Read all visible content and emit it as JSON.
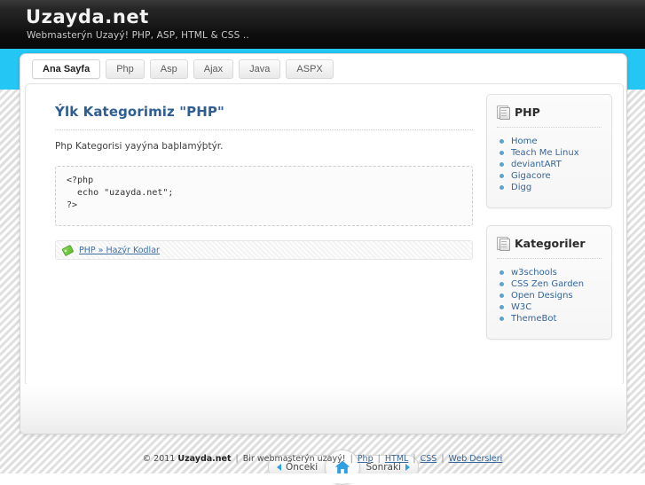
{
  "header": {
    "site_title": "Uzayda.net",
    "tagline": "Webmasterýn Uzayý! PHP, ASP, HTML & CSS .."
  },
  "tabs": [
    {
      "label": "Ana Sayfa",
      "active": true
    },
    {
      "label": "Php",
      "active": false
    },
    {
      "label": "Asp",
      "active": false
    },
    {
      "label": "Ajax",
      "active": false
    },
    {
      "label": "Java",
      "active": false
    },
    {
      "label": "ASPX",
      "active": false
    }
  ],
  "article": {
    "title": "Ýlk Kategorimiz \"PHP\"",
    "intro": "Php Kategorisi yayýna baþlamýþtýr.",
    "code": "<?php\n  echo \"uzayda.net\";\n?>",
    "tag_icon": "tag-icon",
    "tag_label": "PHP » Hazýr Kodlar"
  },
  "sidebar": {
    "widgets": [
      {
        "icon": "page-icon",
        "title": "PHP",
        "items": [
          {
            "label": "Home"
          },
          {
            "label": "Teach Me Linux"
          },
          {
            "label": "deviantART"
          },
          {
            "label": "Gigacore"
          },
          {
            "label": "Digg"
          }
        ]
      },
      {
        "icon": "page-icon",
        "title": "Kategoriler",
        "items": [
          {
            "label": "w3schools"
          },
          {
            "label": "CSS Zen Garden"
          },
          {
            "label": "Open Designs"
          },
          {
            "label": "W3C"
          },
          {
            "label": "ThemeBot"
          }
        ]
      }
    ]
  },
  "pager": {
    "prev_label": "Önceki",
    "next_label": "Sonraki",
    "home_icon": "home-icon",
    "prev_icon": "arrow-left-icon",
    "next_icon": "arrow-right-icon"
  },
  "footer": {
    "copyright": "© 2011",
    "site": "Uzayda.net",
    "sep1": "|",
    "phrase": "Bir webmasterýn uzayý!",
    "sep2": "|",
    "links": [
      {
        "label": "Php"
      },
      {
        "label": "HTML"
      },
      {
        "label": "CSS"
      },
      {
        "label": "Web Dersleri"
      }
    ],
    "link_sep": "|"
  },
  "colors": {
    "accent_cyan": "#24c6f4",
    "link_blue": "#34669b",
    "title_blue": "#2e5e92",
    "header_dark": "#1a1a1a",
    "tag_green": "#5cb82b"
  }
}
